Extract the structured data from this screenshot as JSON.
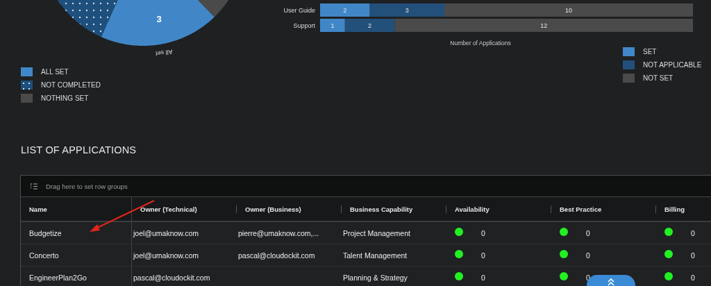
{
  "pie": {
    "value_label": "3",
    "slice_label": "All set",
    "legend": [
      {
        "label": "ALL SET",
        "color": "#4187c8",
        "kind": "solid"
      },
      {
        "label": "NOT COMPLETED",
        "color": "#1f4f7d",
        "kind": "dotted"
      },
      {
        "label": "NOTHING SET",
        "color": "#4a4a4a",
        "kind": "solid"
      }
    ]
  },
  "bar_chart": {
    "chart_data": {
      "type": "bar",
      "orientation": "horizontal",
      "legend": "right",
      "stacked": true,
      "data_labels": true,
      "xlabel": "Number of Applications",
      "categories": [
        "User Guide",
        "Support"
      ],
      "series": [
        {
          "name": "SET",
          "color": "#4187c8",
          "values": [
            2,
            1
          ]
        },
        {
          "name": "NOT APPLICABLE",
          "color": "#23507a",
          "values": [
            3,
            2
          ]
        },
        {
          "name": "NOT SET",
          "color": "#4a4a4a",
          "values": [
            10,
            12
          ]
        }
      ]
    }
  },
  "section_title": "LIST OF APPLICATIONS",
  "grid": {
    "group_bar": "Drag here to set row groups",
    "columns": [
      "Name",
      "Owner (Technical)",
      "Owner (Business)",
      "Business Capability",
      "Availability",
      "Best Practice",
      "Billing"
    ],
    "rows": [
      {
        "name": "Budgetize",
        "owner_technical": "joel@umaknow.com",
        "owner_business": "pierre@umaknow.com,...",
        "business_capability": "Project Management",
        "statuses": [
          {
            "color": "#22f022",
            "value": "0"
          },
          {
            "color": "#22f022",
            "value": "0"
          },
          {
            "color": "#22f022",
            "value": "0"
          }
        ]
      },
      {
        "name": "Concerto",
        "owner_technical": "joel@umaknow.com",
        "owner_business": "pascal@cloudockit.com",
        "business_capability": "Talent Management",
        "statuses": [
          {
            "color": "#22f022",
            "value": "0"
          },
          {
            "color": "#22f022",
            "value": "0"
          },
          {
            "color": "#22f022",
            "value": "0"
          }
        ]
      },
      {
        "name": "EngineerPlan2Go",
        "owner_technical": "pascal@cloudockit.com",
        "business_capability": "Planning & Strategy",
        "statuses": [
          {
            "color": "#22f022",
            "value": "0"
          },
          {
            "color": "#22f022",
            "value": "0"
          },
          {
            "color": "#22f022",
            "value": "0"
          }
        ]
      }
    ]
  }
}
